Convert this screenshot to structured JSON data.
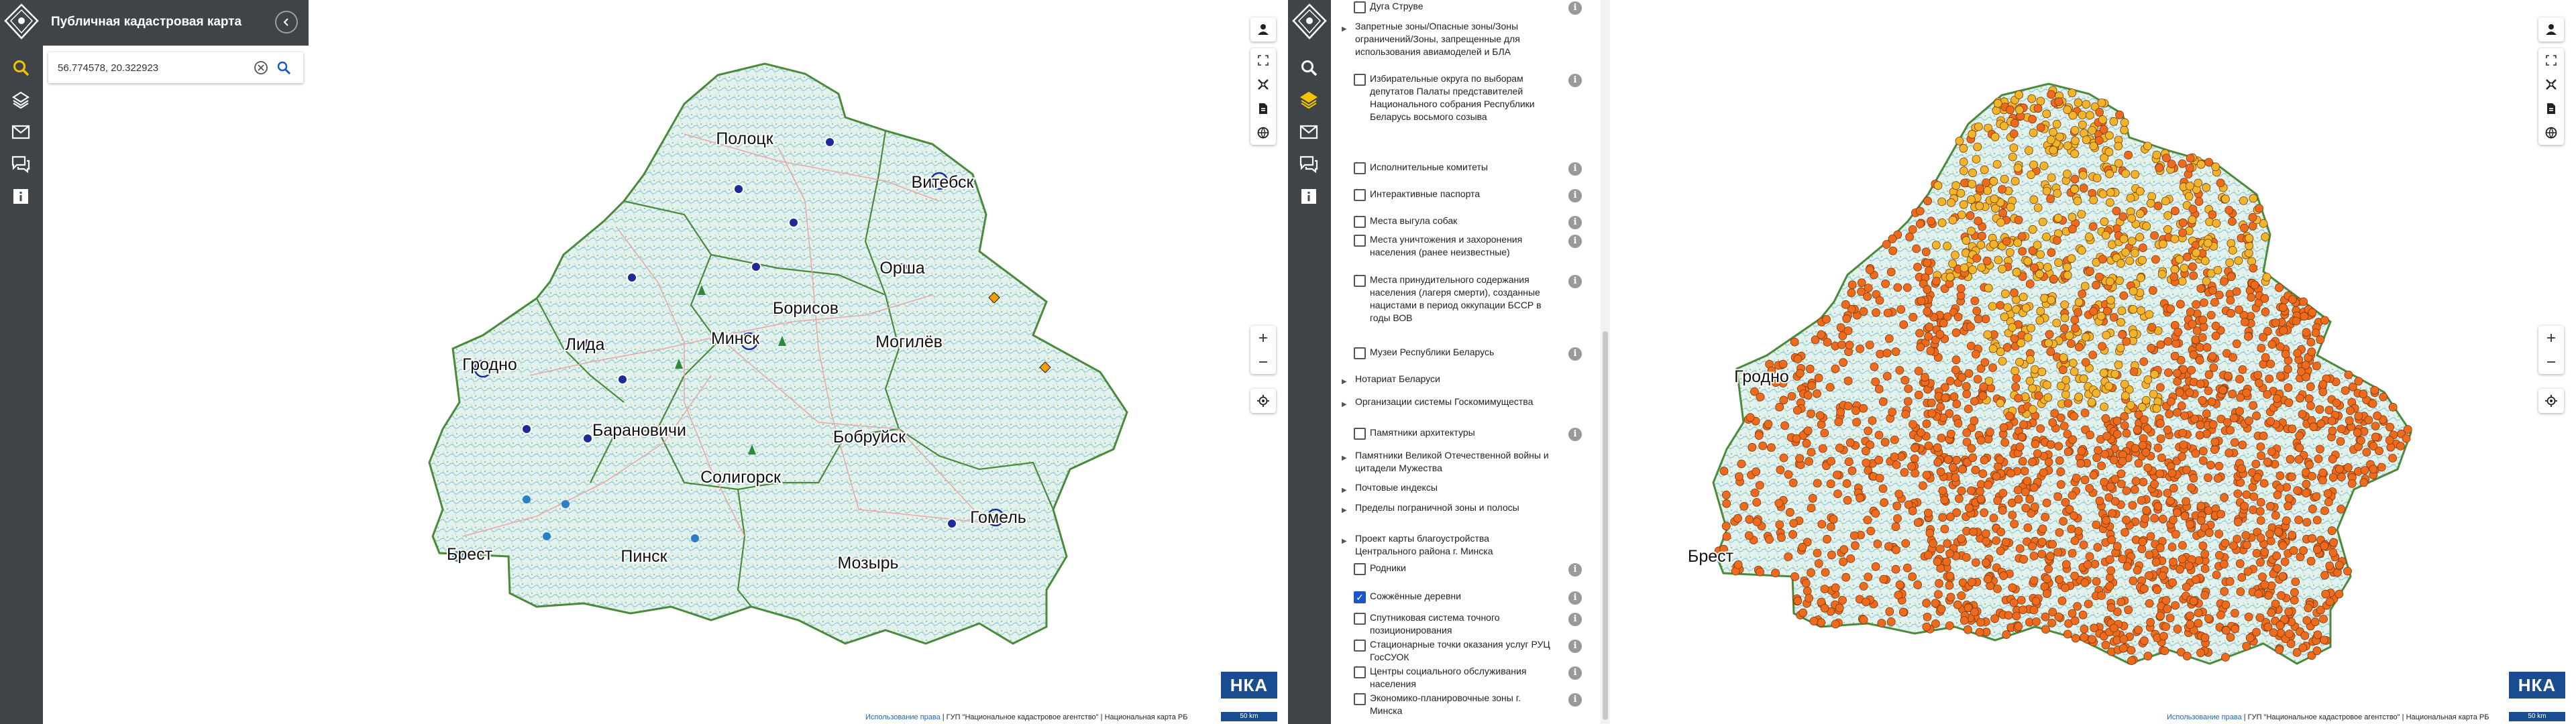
{
  "colors": {
    "rail": "#3f4448",
    "accent_active": "#f2c500",
    "link": "#1767c3",
    "nka_blue": "#1a4d8f",
    "checkbox_on": "#1a56c4"
  },
  "left": {
    "app_title": "Публичная кадастровая карта",
    "search": {
      "value": "56.774578, 20.322923"
    },
    "rail_icons": [
      "search-icon",
      "layers-icon",
      "envelope-icon",
      "chat-icon",
      "info-icon"
    ],
    "cities": [
      "Полоцк",
      "Витебск",
      "Орша",
      "Лида",
      "Борисов",
      "Гродно",
      "Минск",
      "Могилёв",
      "Барановичи",
      "Бобруйск",
      "Солигорск",
      "Брест",
      "Пинск",
      "Гомель",
      "Мозырь"
    ],
    "attribution": {
      "terms": "Использование права",
      "agency": "ГУП \"Национальное кадастровое агентство\"",
      "basemap": "Национальная карта РБ"
    },
    "nka_logo": "НКА",
    "scale": "50 km"
  },
  "right": {
    "layers": [
      {
        "label": "Дуга Струве",
        "kind": "checkbox",
        "checked": false
      },
      {
        "label": "Запретные зоны/Опасные зоны/Зоны ограничений/Зоны, запрещенные для использования авиамоделей и БЛА",
        "kind": "group"
      },
      {
        "label": "Избирательные округа по выборам депутатов Палаты представителей Национального собрания Республики Беларусь восьмого созыва",
        "kind": "checkbox",
        "checked": false
      },
      {
        "label": "Исполнительные комитеты",
        "kind": "checkbox",
        "checked": false
      },
      {
        "label": "Интерактивные паспорта",
        "kind": "checkbox",
        "checked": false
      },
      {
        "label": "Места выгула собак",
        "kind": "checkbox",
        "checked": false
      },
      {
        "label": "Места уничтожения и захоронения населения (ранее неизвестные)",
        "kind": "checkbox",
        "checked": false
      },
      {
        "label": "Места принудительного содержания населения (лагеря смерти), созданные нацистами в период оккупации БССР в годы ВОВ",
        "kind": "checkbox",
        "checked": false
      },
      {
        "label": "Музеи Республики Беларусь",
        "kind": "checkbox",
        "checked": false
      },
      {
        "label": "Нотариат Беларуси",
        "kind": "group"
      },
      {
        "label": "Организации системы Госкомимущества",
        "kind": "group"
      },
      {
        "label": "Памятники архитектуры",
        "kind": "checkbox",
        "checked": false
      },
      {
        "label": "Памятники Великой Отечественной войны и цитадели Мужества",
        "kind": "group"
      },
      {
        "label": "Почтовые индексы",
        "kind": "group"
      },
      {
        "label": "Пределы пограничной зоны и полосы",
        "kind": "group"
      },
      {
        "label": "Проект карты благоустройства Центрального района г. Минска",
        "kind": "group"
      },
      {
        "label": "Родники",
        "kind": "checkbox",
        "checked": false
      },
      {
        "label": "Сожжённые деревни",
        "kind": "checkbox",
        "checked": true
      },
      {
        "label": "Спутниковая система точного позиционирования",
        "kind": "checkbox",
        "checked": false
      },
      {
        "label": "Стационарные точки оказания услуг РУЦ ГосСУОК",
        "kind": "checkbox",
        "checked": false
      },
      {
        "label": "Центры социального обслуживания населения",
        "kind": "checkbox",
        "checked": false
      },
      {
        "label": "Экономико-планировочные зоны г. Минска",
        "kind": "checkbox",
        "checked": false
      }
    ],
    "cities": [
      "Гродно",
      "Брест"
    ],
    "attribution": {
      "terms": "Использование права",
      "agency": "ГУП \"Национальное кадастровое агентство\"",
      "basemap": "Национальная карта РБ"
    },
    "nka_logo": "НКА",
    "scale": "50 km"
  }
}
